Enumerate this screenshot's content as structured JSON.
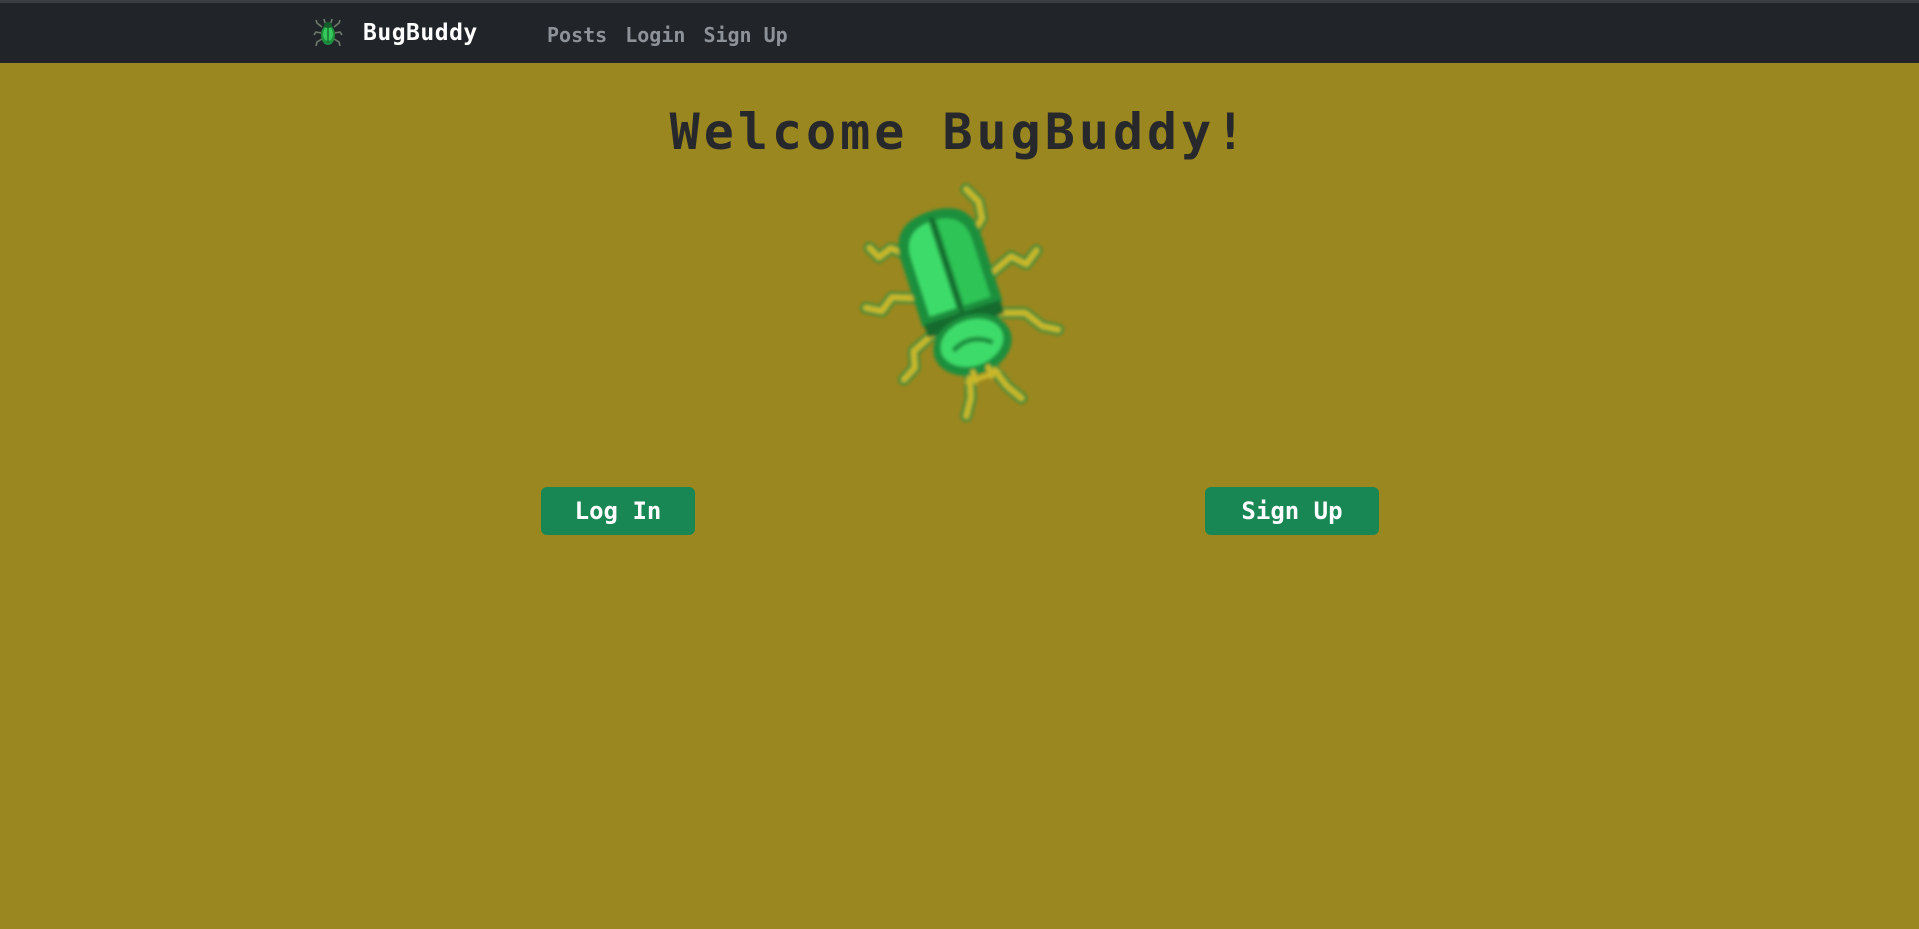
{
  "navbar": {
    "brand_icon": "beetle-icon",
    "brand_name": "BugBuddy",
    "links": [
      {
        "label": "Posts"
      },
      {
        "label": "Login"
      },
      {
        "label": "Sign Up"
      }
    ]
  },
  "main": {
    "title": "Welcome BugBuddy!",
    "hero_image": "green-beetle-illustration",
    "login_button": "Log In",
    "signup_button": "Sign Up"
  },
  "colors": {
    "page_background": "#9b871f",
    "navbar_background": "#212529",
    "button_green": "#198754",
    "title_text": "#26282c",
    "bug_green": "#2ecc57",
    "bug_legs": "#c9b72a"
  }
}
